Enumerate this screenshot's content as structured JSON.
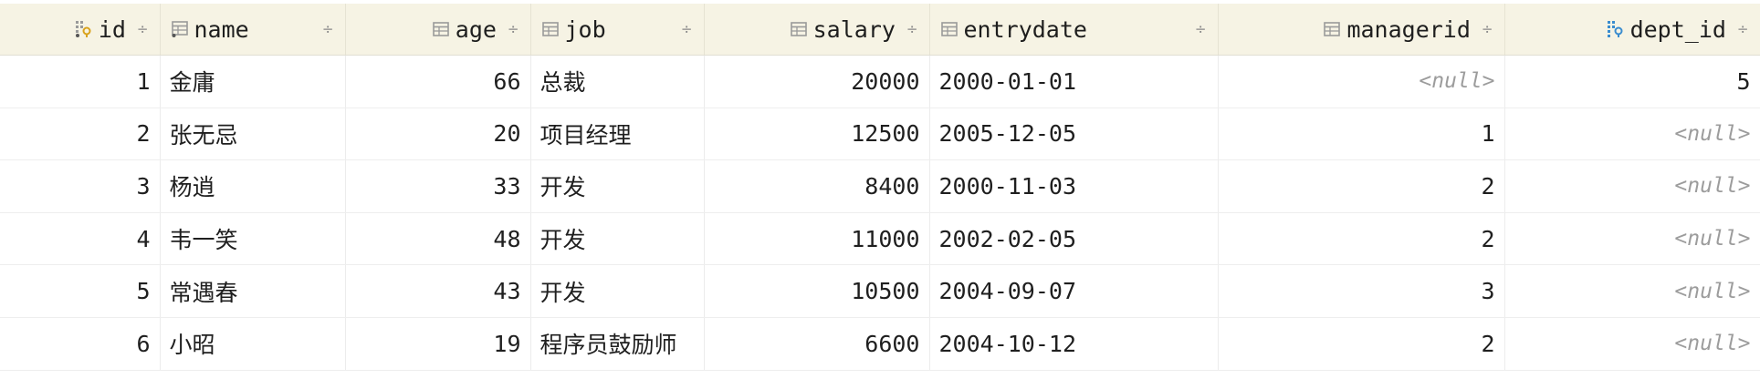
{
  "table": {
    "columns": [
      {
        "label": "id",
        "icon": "primary-key-column-icon",
        "align": "right"
      },
      {
        "label": "name",
        "icon": "column-not-null-icon",
        "align": "left"
      },
      {
        "label": "age",
        "icon": "column-icon",
        "align": "right"
      },
      {
        "label": "job",
        "icon": "column-icon",
        "align": "left"
      },
      {
        "label": "salary",
        "icon": "column-icon",
        "align": "right"
      },
      {
        "label": "entrydate",
        "icon": "column-icon",
        "align": "left"
      },
      {
        "label": "managerid",
        "icon": "column-icon",
        "align": "right"
      },
      {
        "label": "dept_id",
        "icon": "foreign-key-column-icon",
        "align": "right"
      }
    ],
    "sort_glyph": "÷",
    "null_text": "<null>",
    "rows": [
      {
        "id": "1",
        "name": "金庸",
        "age": "66",
        "job": "总裁",
        "salary": "20000",
        "entrydate": "2000-01-01",
        "managerid": null,
        "dept_id": "5"
      },
      {
        "id": "2",
        "name": "张无忌",
        "age": "20",
        "job": "项目经理",
        "salary": "12500",
        "entrydate": "2005-12-05",
        "managerid": "1",
        "dept_id": null
      },
      {
        "id": "3",
        "name": "杨逍",
        "age": "33",
        "job": "开发",
        "salary": "8400",
        "entrydate": "2000-11-03",
        "managerid": "2",
        "dept_id": null
      },
      {
        "id": "4",
        "name": "韦一笑",
        "age": "48",
        "job": "开发",
        "salary": "11000",
        "entrydate": "2002-02-05",
        "managerid": "2",
        "dept_id": null
      },
      {
        "id": "5",
        "name": "常遇春",
        "age": "43",
        "job": "开发",
        "salary": "10500",
        "entrydate": "2004-09-07",
        "managerid": "3",
        "dept_id": null
      },
      {
        "id": "6",
        "name": "小昭",
        "age": "19",
        "job": "程序员鼓励师",
        "salary": "6600",
        "entrydate": "2004-10-12",
        "managerid": "2",
        "dept_id": null
      }
    ]
  },
  "colors": {
    "header_bg": "#f6f3e4",
    "key_gold": "#d9a21b",
    "fk_blue": "#3a8ccf",
    "null_gray": "#9c9c9c"
  }
}
